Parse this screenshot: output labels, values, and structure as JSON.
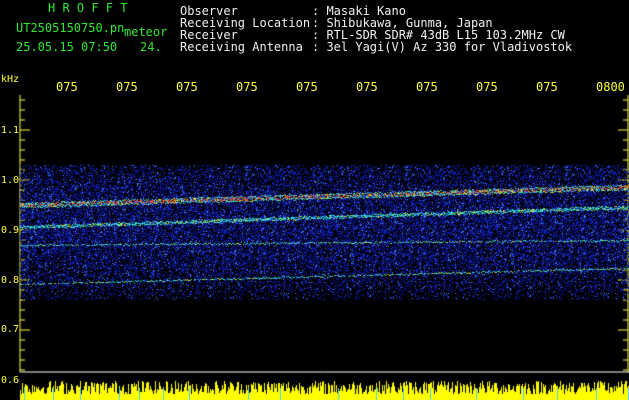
{
  "header": {
    "app_name": "H R O F F T",
    "filename": "UT2505150750.pn",
    "mode": "meteor",
    "date_time": "25.05.15 07:50",
    "count": "24.",
    "labels": [
      "Observer",
      "Receiving Location",
      "Receiver",
      "Receiving Antenna"
    ],
    "values": [
      ": Masaki Kano",
      ": Shibukawa, Gunma, Japan",
      ": RTL-SDR SDR# 43dB L15 103.2MHz CW",
      ": 3el Yagi(V) Az 330 for Vladivostok"
    ]
  },
  "spectrogram": {
    "y_unit": "kHz",
    "y_ticks": [
      "1.1",
      "1.0",
      "0.9",
      "0.8",
      "0.7",
      "0.6"
    ],
    "time_ticks": [
      "075",
      "075",
      "075",
      "075",
      "075",
      "075",
      "075",
      "075",
      "075",
      "0800"
    ],
    "colors": {
      "background": "#000000",
      "noise": "#1020c0",
      "signal": "#e8301c",
      "tick": "#ffff3a",
      "meter": "#ffff00"
    }
  }
}
